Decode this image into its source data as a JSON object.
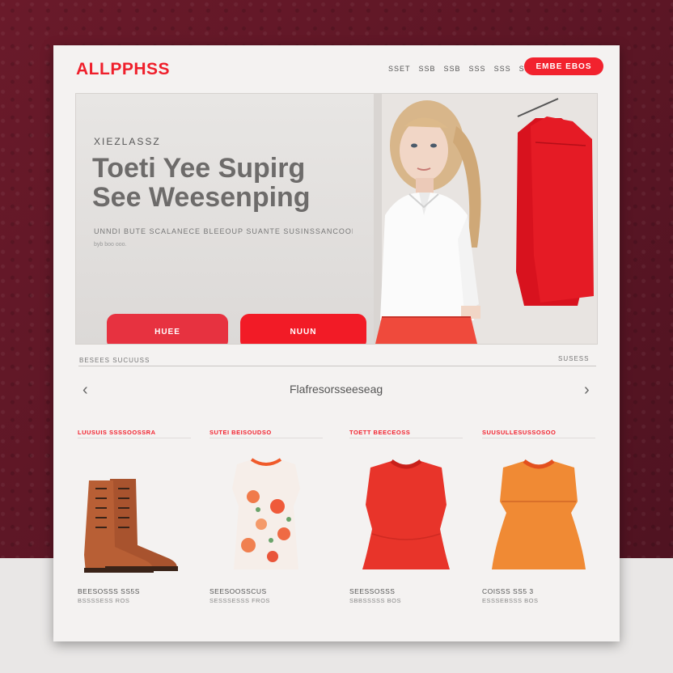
{
  "header": {
    "logo": "ALLPPHSS",
    "nav": [
      "SSET",
      "SSB",
      "SSB",
      "SSS",
      "SSS",
      "SSS"
    ],
    "cta_label": "EMBE EBOS"
  },
  "hero": {
    "eyebrow": "XIEZLASSZ",
    "headline_line1": "Toeti Yee Supirg",
    "headline_line2": "See Weesenping",
    "subline": "UNNDI BUTE SCALANECE BLEEOUP SUANTE SUSINSSANCOOM",
    "fine_print": "byb boo ooo.",
    "button_primary": "HUEE",
    "button_secondary": "NUUN"
  },
  "section": {
    "label_left": "BESEES SUCUUSS",
    "label_right": "SUSESS",
    "category_title": "Flafresorsseeseag"
  },
  "products": [
    {
      "label": "LUUSUIS SSSSOOSSRA",
      "name": "BEESOSSS SS5S",
      "price": "BSSSSESS ROS"
    },
    {
      "label": "SUTEI BEISOUDSO",
      "name": "SEESOOSSCUS",
      "price": "SESSSESSS FROS"
    },
    {
      "label": "TOETT BEECEOSS",
      "name": "SEESSOSSS",
      "price": "SBBSSSSS BOS"
    },
    {
      "label": "SUUSULLESUSSOSOO",
      "name": "COISSS SS5 3",
      "price": "ESSSEBSSS BOS"
    }
  ],
  "colors": {
    "accent": "#f2222e",
    "background": "#5b1624",
    "card": "#f4f2f1"
  }
}
